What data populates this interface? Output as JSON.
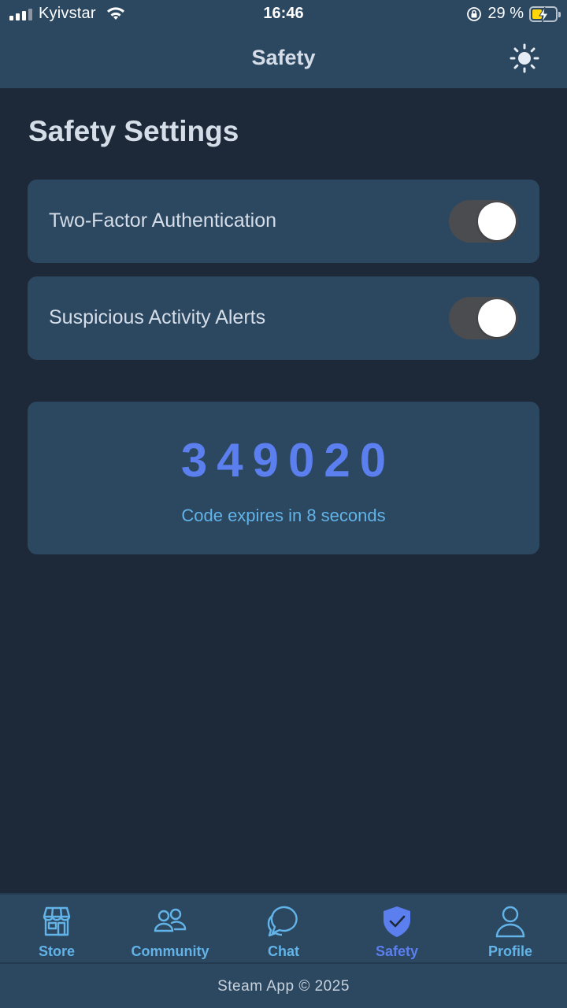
{
  "status_bar": {
    "carrier": "Kyivstar",
    "time": "16:46",
    "battery_percent": "29 %",
    "battery_level": 0.29
  },
  "header": {
    "title": "Safety",
    "theme_icon": "sun-icon"
  },
  "page": {
    "title": "Safety Settings"
  },
  "settings": [
    {
      "label": "Two-Factor Authentication",
      "enabled": true
    },
    {
      "label": "Suspicious Activity Alerts",
      "enabled": true
    }
  ],
  "code_card": {
    "code": "349020",
    "expiry_text": "Code expires in 8 seconds"
  },
  "tabs": [
    {
      "label": "Store",
      "icon": "store-icon",
      "active": false
    },
    {
      "label": "Community",
      "icon": "community-icon",
      "active": false
    },
    {
      "label": "Chat",
      "icon": "chat-icon",
      "active": false
    },
    {
      "label": "Safety",
      "icon": "shield-check-icon",
      "active": true
    },
    {
      "label": "Profile",
      "icon": "profile-icon",
      "active": false
    }
  ],
  "footer": {
    "text": "Steam App © 2025"
  },
  "colors": {
    "background": "#1d2838",
    "surface": "#2c4760",
    "accent": "#5b7fef",
    "link": "#62b4e8"
  }
}
